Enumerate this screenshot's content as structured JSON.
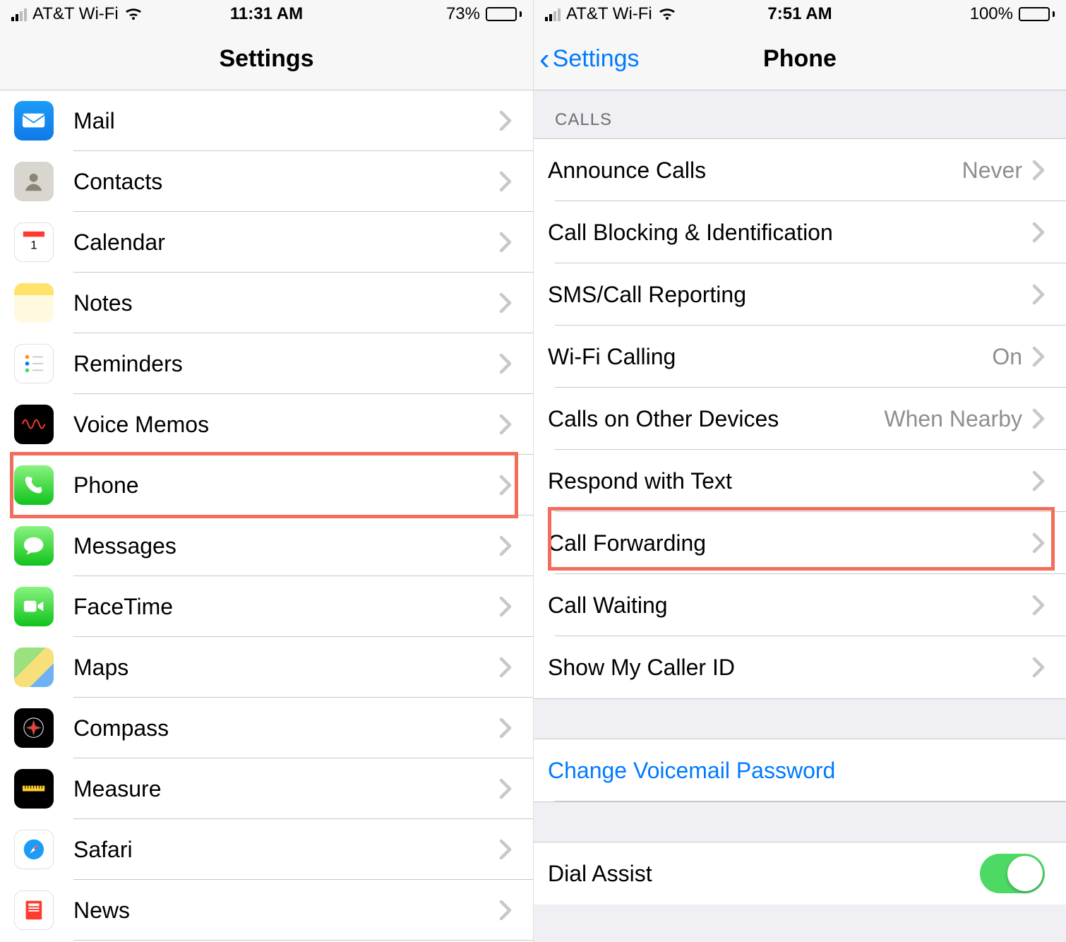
{
  "left": {
    "status": {
      "carrier": "AT&T Wi-Fi",
      "time": "11:31 AM",
      "battery_pct": "73%",
      "battery_fill": 73
    },
    "nav": {
      "title": "Settings"
    },
    "rows": [
      {
        "id": "mail",
        "label": "Mail",
        "icon": "mail-icon"
      },
      {
        "id": "contacts",
        "label": "Contacts",
        "icon": "contacts-icon"
      },
      {
        "id": "calendar",
        "label": "Calendar",
        "icon": "calendar-icon"
      },
      {
        "id": "notes",
        "label": "Notes",
        "icon": "notes-icon"
      },
      {
        "id": "reminders",
        "label": "Reminders",
        "icon": "reminders-icon"
      },
      {
        "id": "voicememos",
        "label": "Voice Memos",
        "icon": "voicememos-icon"
      },
      {
        "id": "phone",
        "label": "Phone",
        "icon": "phone-icon",
        "highlighted": true
      },
      {
        "id": "messages",
        "label": "Messages",
        "icon": "messages-icon"
      },
      {
        "id": "facetime",
        "label": "FaceTime",
        "icon": "facetime-icon"
      },
      {
        "id": "maps",
        "label": "Maps",
        "icon": "maps-icon"
      },
      {
        "id": "compass",
        "label": "Compass",
        "icon": "compass-icon"
      },
      {
        "id": "measure",
        "label": "Measure",
        "icon": "measure-icon"
      },
      {
        "id": "safari",
        "label": "Safari",
        "icon": "safari-icon"
      },
      {
        "id": "news",
        "label": "News",
        "icon": "news-icon"
      }
    ]
  },
  "right": {
    "status": {
      "carrier": "AT&T Wi-Fi",
      "time": "7:51 AM",
      "battery_pct": "100%",
      "battery_fill": 100
    },
    "nav": {
      "back": "Settings",
      "title": "Phone"
    },
    "section_header": "CALLS",
    "rows_calls": [
      {
        "id": "announce-calls",
        "label": "Announce Calls",
        "detail": "Never"
      },
      {
        "id": "call-blocking",
        "label": "Call Blocking & Identification"
      },
      {
        "id": "sms-call-reporting",
        "label": "SMS/Call Reporting"
      },
      {
        "id": "wifi-calling",
        "label": "Wi-Fi Calling",
        "detail": "On"
      },
      {
        "id": "calls-other-devices",
        "label": "Calls on Other Devices",
        "detail": "When Nearby"
      },
      {
        "id": "respond-with-text",
        "label": "Respond with Text"
      },
      {
        "id": "call-forwarding",
        "label": "Call Forwarding",
        "highlighted": true
      },
      {
        "id": "call-waiting",
        "label": "Call Waiting"
      },
      {
        "id": "show-caller-id",
        "label": "Show My Caller ID"
      }
    ],
    "voicemail_link": "Change Voicemail Password",
    "dial_assist": {
      "label": "Dial Assist",
      "on": true
    }
  }
}
